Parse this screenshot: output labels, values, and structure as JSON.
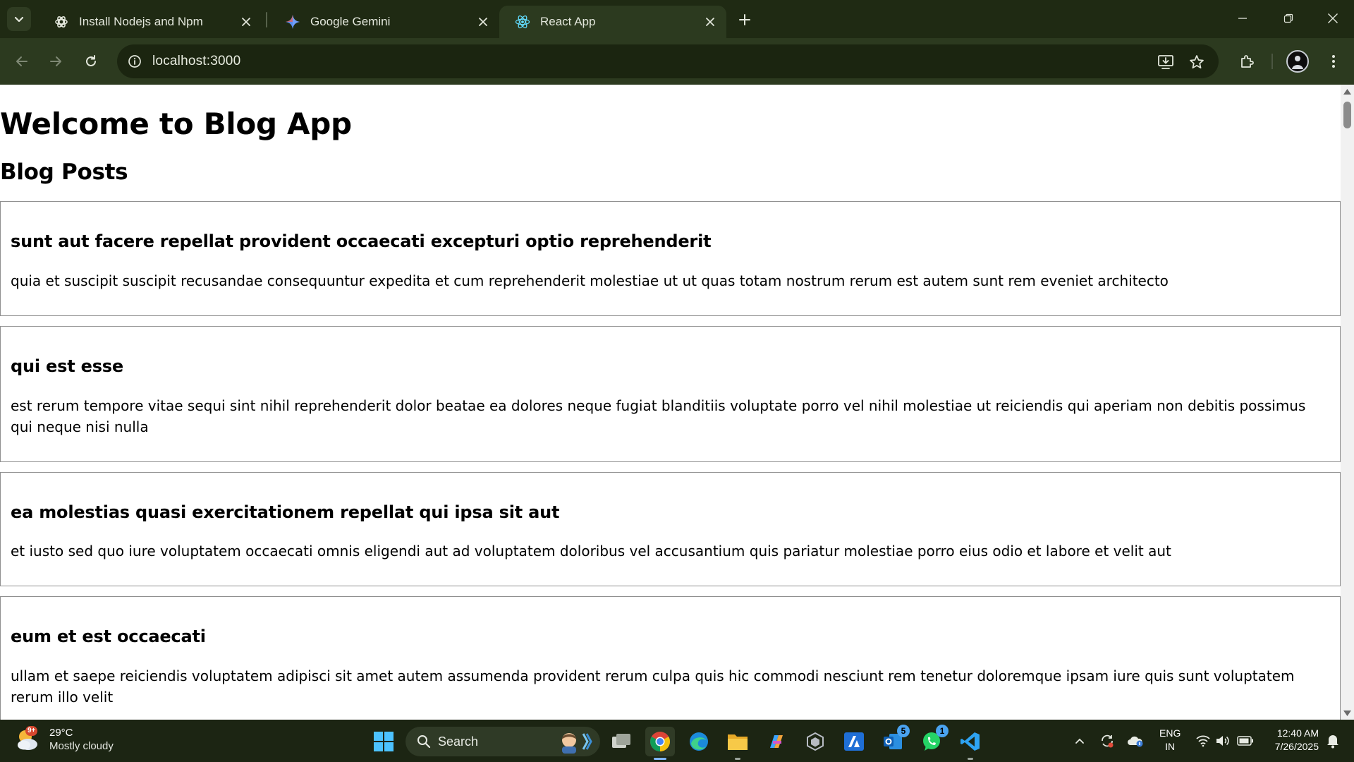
{
  "browser": {
    "tabs": [
      {
        "title": "Install Nodejs and Npm",
        "icon": "openai-icon"
      },
      {
        "title": "Google Gemini",
        "icon": "gemini-icon"
      },
      {
        "title": "React App",
        "icon": "react-icon"
      }
    ],
    "url": "localhost:3000",
    "accent": "#2c3a1f"
  },
  "page": {
    "heading": "Welcome to Blog App",
    "subheading": "Blog Posts",
    "posts": [
      {
        "title": "sunt aut facere repellat provident occaecati excepturi optio reprehenderit",
        "body": "quia et suscipit suscipit recusandae consequuntur expedita et cum reprehenderit molestiae ut ut quas totam nostrum rerum est autem sunt rem eveniet architecto"
      },
      {
        "title": "qui est esse",
        "body": "est rerum tempore vitae sequi sint nihil reprehenderit dolor beatae ea dolores neque fugiat blanditiis voluptate porro vel nihil molestiae ut reiciendis qui aperiam non debitis possimus qui neque nisi nulla"
      },
      {
        "title": "ea molestias quasi exercitationem repellat qui ipsa sit aut",
        "body": "et iusto sed quo iure voluptatem occaecati omnis eligendi aut ad voluptatem doloribus vel accusantium quis pariatur molestiae porro eius odio et labore et velit aut"
      },
      {
        "title": "eum et est occaecati",
        "body": "ullam et saepe reiciendis voluptatem adipisci sit amet autem assumenda provident rerum culpa quis hic commodi nesciunt rem tenetur doloremque ipsam iure quis sunt voluptatem rerum illo velit"
      }
    ]
  },
  "taskbar": {
    "weather": {
      "badge": "9+",
      "temp": "29°C",
      "condition": "Mostly cloudy"
    },
    "search_label": "Search",
    "badges": {
      "outlook": "5",
      "whatsapp": "1"
    },
    "lang": {
      "line1": "ENG",
      "line2": "IN"
    },
    "clock": {
      "time": "12:40 AM",
      "date": "7/26/2025"
    }
  }
}
